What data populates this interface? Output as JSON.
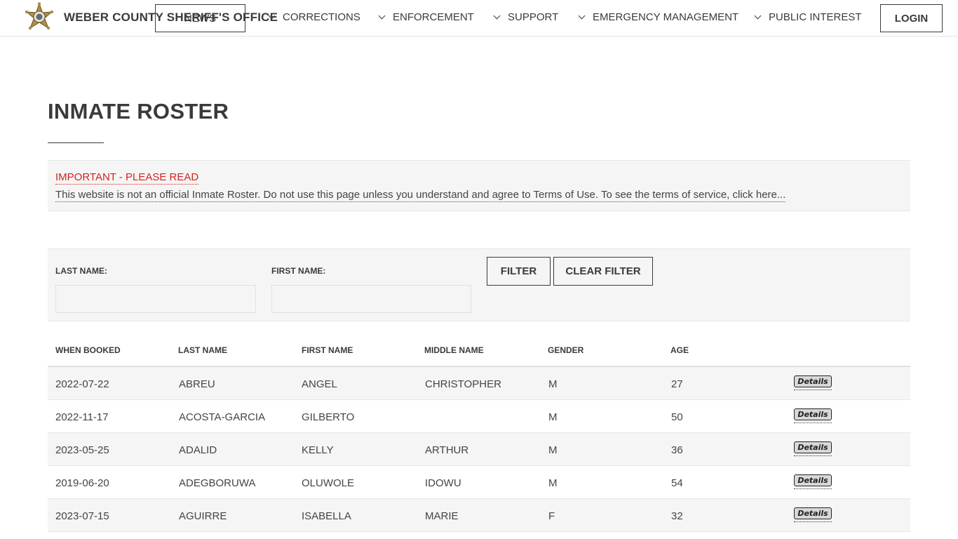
{
  "header": {
    "site_title": "WEBER COUNTY SHERIFF'S OFFICE",
    "news_button": "NEWS",
    "nav": [
      "CORRECTIONS",
      "ENFORCEMENT",
      "SUPPORT",
      "EMERGENCY MANAGEMENT",
      "PUBLIC INTEREST"
    ],
    "login_label": "LOGIN",
    "logo_icon": "sheriff-star-badge-icon",
    "colors": {
      "text": "#3a3a3a",
      "badge_gold": "#b08d4b"
    }
  },
  "page": {
    "title": "INMATE ROSTER"
  },
  "notice": {
    "heading": "IMPORTANT - PLEASE READ",
    "body": "This website is not an official Inmate Roster. Do not use this page unless you understand and agree to Terms of Use. To see the terms of service, click here...",
    "color": "#d71f1f"
  },
  "filter": {
    "last_name_label": "LAST NAME:",
    "first_name_label": "FIRST NAME:",
    "last_name_value": "",
    "first_name_value": "",
    "filter_label": "FILTER",
    "clear_label": "CLEAR FILTER"
  },
  "table": {
    "headers": [
      "WHEN BOOKED",
      "LAST NAME",
      "FIRST NAME",
      "MIDDLE NAME",
      "GENDER",
      "AGE"
    ],
    "details_label": "Details",
    "rows": [
      [
        "2022-07-22",
        "ABREU",
        "ANGEL",
        "CHRISTOPHER",
        "M",
        "27"
      ],
      [
        "2022-11-17",
        "ACOSTA-GARCIA",
        "GILBERTO",
        "",
        "M",
        "50"
      ],
      [
        "2023-05-25",
        "ADALID",
        "KELLY",
        "ARTHUR",
        "M",
        "36"
      ],
      [
        "2019-06-20",
        "ADEGBORUWA",
        "OLUWOLE",
        "IDOWU",
        "M",
        "54"
      ],
      [
        "2023-07-15",
        "AGUIRRE",
        "ISABELLA",
        "MARIE",
        "F",
        "32"
      ]
    ]
  }
}
